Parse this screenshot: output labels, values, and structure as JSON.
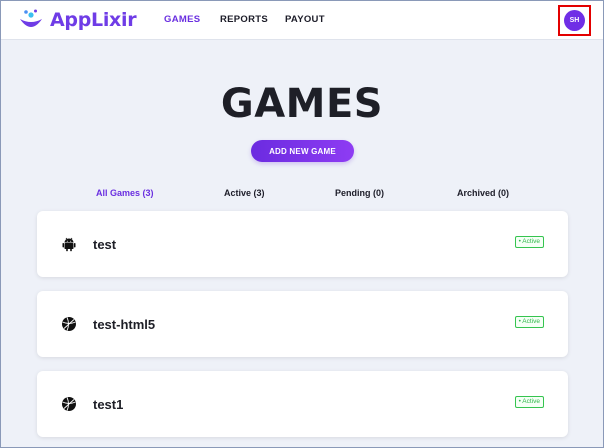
{
  "header": {
    "brand": "AppLixir",
    "nav": [
      {
        "label": "GAMES",
        "active": true
      },
      {
        "label": "REPORTS",
        "active": false
      },
      {
        "label": "PAYOUT",
        "active": false
      }
    ],
    "avatar_initials": "SH"
  },
  "page": {
    "title": "GAMES",
    "add_button": "ADD NEW GAME"
  },
  "filters": [
    {
      "label": "All Games (3)",
      "active": true
    },
    {
      "label": "Active (3)",
      "active": false
    },
    {
      "label": "Pending (0)",
      "active": false
    },
    {
      "label": "Archived (0)",
      "active": false
    }
  ],
  "games": [
    {
      "name": "test",
      "platform_icon": "android-icon",
      "status": "• Active"
    },
    {
      "name": "test-html5",
      "platform_icon": "html5-ball-icon",
      "status": "• Active"
    },
    {
      "name": "test1",
      "platform_icon": "html5-ball-icon",
      "status": "• Active"
    }
  ],
  "colors": {
    "brand": "#6f3ce6",
    "accent": "#6a2fe0",
    "status_active": "#2fb84a",
    "highlight_border": "#e30000"
  }
}
